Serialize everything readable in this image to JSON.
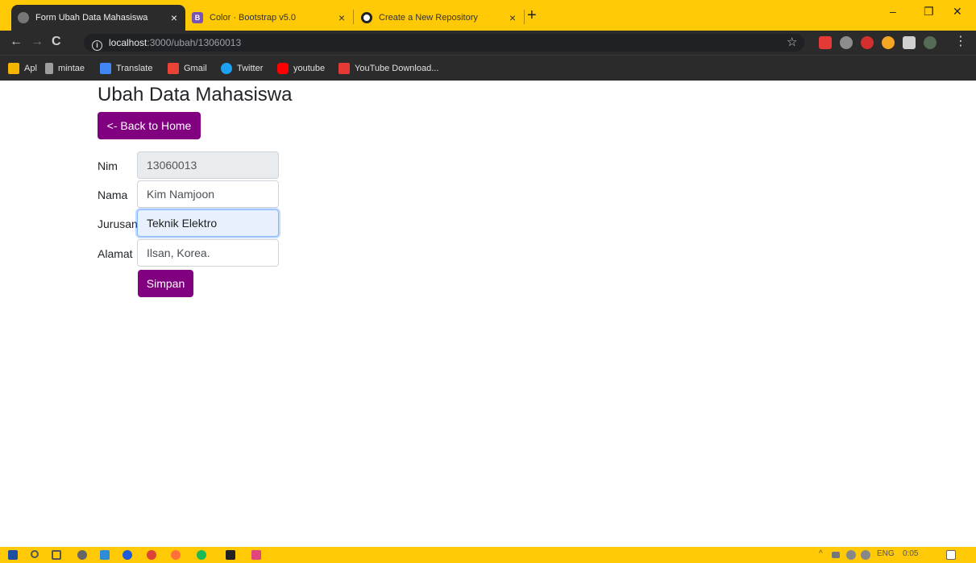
{
  "browser": {
    "tabs": [
      {
        "title": "Form Ubah Data Mahasiswa",
        "close": "×"
      },
      {
        "title": "Color · Bootstrap v5.0",
        "favicon_letter": "B",
        "close": "×"
      },
      {
        "title": "Create a New Repository",
        "close": "×"
      }
    ],
    "new_tab": "+",
    "window_controls": {
      "minimize": "–",
      "restore": "❐",
      "close": "✕"
    },
    "nav": {
      "back": "←",
      "forward": "→",
      "reload": "C",
      "menu": "⋮",
      "star": "☆"
    },
    "address": {
      "info": "i",
      "host": "localhost",
      "path": ":3000/ubah/13060013"
    },
    "bookmarks": [
      {
        "label": "Apl",
        "icon": "apps-grid-icon",
        "color": "#f4b400"
      },
      {
        "label": "mintae",
        "icon": "mintae-icon",
        "color": "#9e9e9e"
      },
      {
        "label": "Translate",
        "icon": "translate-icon",
        "color": "#4285f4"
      },
      {
        "label": "Gmail",
        "icon": "gmail-icon",
        "color": "#ea4335"
      },
      {
        "label": "Twitter",
        "icon": "twitter-icon",
        "color": "#1da1f2"
      },
      {
        "label": "youtube",
        "icon": "youtube-icon",
        "color": "#ff0000"
      },
      {
        "label": "YouTube Download...",
        "icon": "download-icon",
        "color": "#e53935"
      }
    ]
  },
  "page": {
    "title": "Ubah Data Mahasiswa",
    "back_button": "<- Back to Home",
    "form": {
      "nim": {
        "label": "Nim",
        "value": "13060013"
      },
      "nama": {
        "label": "Nama",
        "value": "Kim Namjoon"
      },
      "jurusan": {
        "label": "Jurusan",
        "value": "Teknik Elektro"
      },
      "alamat": {
        "label": "Alamat",
        "value": "Ilsan, Korea."
      }
    },
    "submit_button": "Simpan"
  },
  "taskbar": {
    "tray": {
      "chevron": "^",
      "language": "ENG",
      "time": "0:05"
    }
  },
  "colors": {
    "accent_purple": "#800080",
    "browser_frame": "#ffc905",
    "toolbar_dark": "#2b2b2b"
  }
}
